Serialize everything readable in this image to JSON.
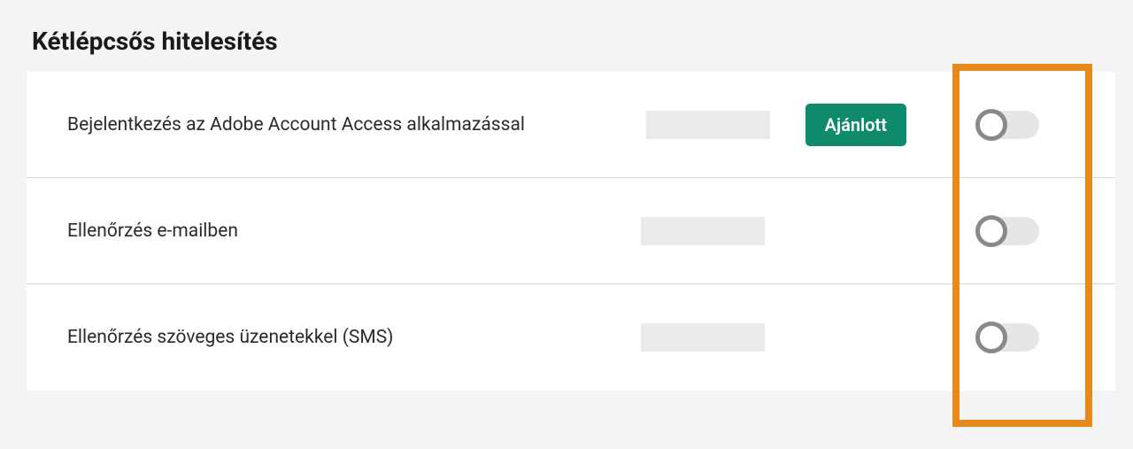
{
  "section": {
    "title": "Kétlépcsős hitelesítés"
  },
  "rows": [
    {
      "label": "Bejelentkezés az Adobe Account Access alkalmazással",
      "badge": "Ajánlott",
      "toggle": false
    },
    {
      "label": "Ellenőrzés e-mailben",
      "badge": null,
      "toggle": false
    },
    {
      "label": "Ellenőrzés szöveges üzenetekkel (SMS)",
      "badge": null,
      "toggle": false
    }
  ],
  "highlight": {
    "color": "#e68a1e"
  }
}
